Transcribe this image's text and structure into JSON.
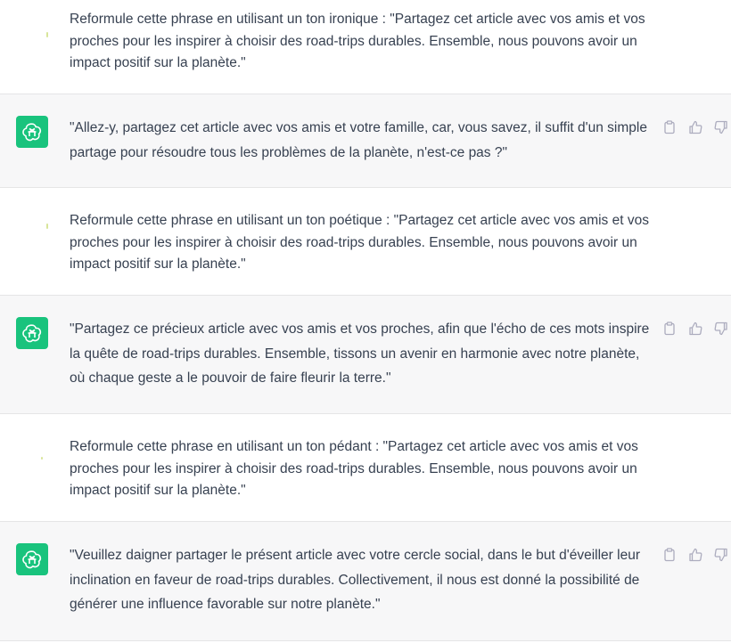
{
  "messages": [
    {
      "role": "user",
      "text": "Reformule cette phrase en utilisant un ton ironique : \"Partagez cet article avec vos amis et vos proches pour les inspirer à choisir des road-trips durables. Ensemble, nous pouvons avoir un impact positif sur la planète.\""
    },
    {
      "role": "assistant",
      "text": "\"Allez-y, partagez cet article avec vos amis et votre famille, car, vous savez, il suffit d'un simple partage pour résoudre tous les problèmes de la planète, n'est-ce pas ?\""
    },
    {
      "role": "user",
      "text": "Reformule cette phrase en utilisant un ton poétique : \"Partagez cet article avec vos amis et vos proches pour les inspirer à choisir des road-trips durables. Ensemble, nous pouvons avoir un impact positif sur la planète.\""
    },
    {
      "role": "assistant",
      "text": "\"Partagez ce précieux article avec vos amis et vos proches, afin que l'écho de ces mots inspire la quête de road-trips durables. Ensemble, tissons un avenir en harmonie avec notre planète, où chaque geste a le pouvoir de faire fleurir la terre.\""
    },
    {
      "role": "user",
      "text": "Reformule cette phrase en utilisant un ton pédant : \"Partagez cet article avec vos amis et vos proches pour les inspirer à choisir des road-trips durables. Ensemble, nous pouvons avoir un impact positif sur la planète.\""
    },
    {
      "role": "assistant",
      "text": "\"Veuillez daigner partager le présent article avec votre cercle social, dans le but d'éveiller leur inclination en faveur de road-trips durables. Collectivement, il nous est donné la possibilité de générer une influence favorable sur notre planète.\""
    }
  ],
  "icons": {
    "avatar": "openai-logo-icon",
    "copy": "clipboard-icon",
    "like": "thumbs-up-icon",
    "dislike": "thumbs-down-icon"
  },
  "colors": {
    "assistant_avatar_bg": "#19c37d",
    "assistant_row_bg": "#f7f7f8",
    "user_row_bg": "#ffffff",
    "text": "#374151",
    "icon": "#acacbe"
  }
}
